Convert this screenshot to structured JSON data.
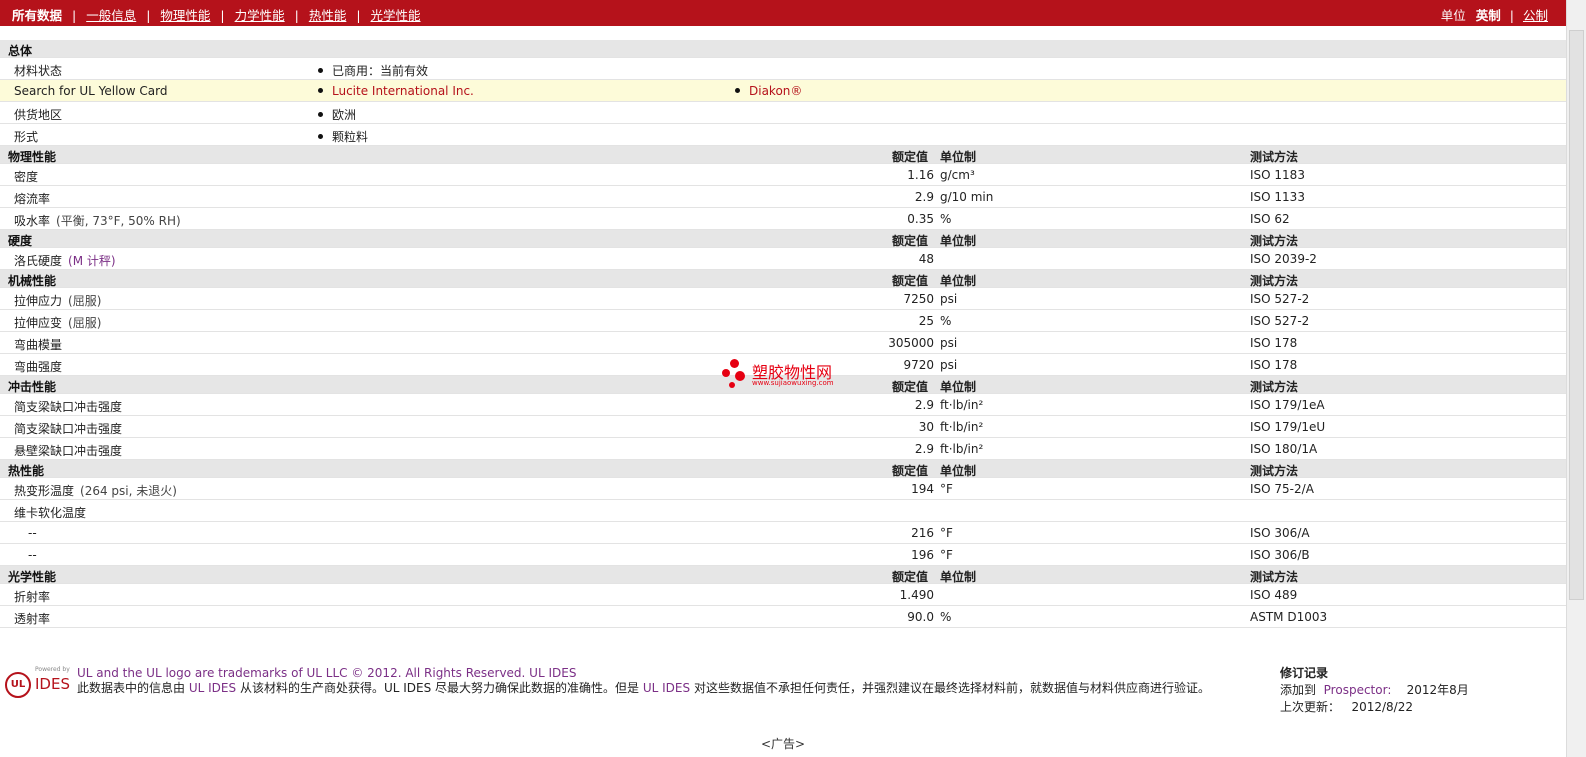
{
  "nav": {
    "current": "所有数据",
    "links": [
      "一般信息",
      "物理性能",
      "力学性能",
      "热性能",
      "光学性能"
    ],
    "separator": "|"
  },
  "units": {
    "label": "单位",
    "current": "英制",
    "separator": "|",
    "alt": "公制"
  },
  "general": {
    "title": "总体",
    "rows": [
      {
        "label": "材料状态",
        "value1": "已商用：当前有效",
        "value2": ""
      },
      {
        "label": "Search for UL Yellow Card",
        "value1": "Lucite International Inc.",
        "value2": "Diakon®"
      },
      {
        "label": "供货地区",
        "value1": "欧洲",
        "value2": ""
      },
      {
        "label": "形式",
        "value1": "颗粒料",
        "value2": ""
      }
    ]
  },
  "columns": {
    "value": "额定值",
    "unit": "单位制",
    "method": "测试方法"
  },
  "sections": [
    {
      "title": "物理性能",
      "rows": [
        {
          "label": "密度",
          "qualifier": "",
          "value": "1.16",
          "unit": "g/cm³",
          "method": "ISO 1183"
        },
        {
          "label": "熔流率",
          "qualifier": "",
          "value": "2.9",
          "unit": "g/10 min",
          "method": "ISO 1133"
        },
        {
          "label": "吸水率",
          "qualifier": "(平衡, 73°F, 50% RH)",
          "value": "0.35",
          "unit": "%",
          "method": "ISO 62"
        }
      ]
    },
    {
      "title": "硬度",
      "rows": [
        {
          "label": "洛氏硬度",
          "qualifier": "(M 计秤)",
          "value": "48",
          "unit": "",
          "method": "ISO 2039-2"
        }
      ]
    },
    {
      "title": "机械性能",
      "rows": [
        {
          "label": "拉伸应力",
          "qualifier": "(屈服)",
          "value": "7250",
          "unit": "psi",
          "method": "ISO 527-2"
        },
        {
          "label": "拉伸应变",
          "qualifier": "(屈服)",
          "value": "25",
          "unit": "%",
          "method": "ISO 527-2"
        },
        {
          "label": "弯曲模量",
          "qualifier": "",
          "value": "305000",
          "unit": "psi",
          "method": "ISO 178"
        },
        {
          "label": "弯曲强度",
          "qualifier": "",
          "value": "9720",
          "unit": "psi",
          "method": "ISO 178"
        }
      ]
    },
    {
      "title": "冲击性能",
      "rows": [
        {
          "label": "简支梁缺口冲击强度",
          "qualifier": "",
          "value": "2.9",
          "unit": "ft·lb/in²",
          "method": "ISO 179/1eA"
        },
        {
          "label": "简支梁缺口冲击强度",
          "qualifier": "",
          "value": "30",
          "unit": "ft·lb/in²",
          "method": "ISO 179/1eU"
        },
        {
          "label": "悬壁梁缺口冲击强度",
          "qualifier": "",
          "value": "2.9",
          "unit": "ft·lb/in²",
          "method": "ISO 180/1A"
        }
      ]
    },
    {
      "title": "热性能",
      "rows": [
        {
          "label": "热变形温度",
          "qualifier": "(264 psi, 未退火)",
          "value": "194",
          "unit": "°F",
          "method": "ISO 75-2/A"
        },
        {
          "label": "维卡软化温度",
          "qualifier": "",
          "value": "",
          "unit": "",
          "method": ""
        },
        {
          "label": "--",
          "qualifier": "",
          "value": "216",
          "unit": "°F",
          "method": "ISO 306/A",
          "sub": true
        },
        {
          "label": "--",
          "qualifier": "",
          "value": "196",
          "unit": "°F",
          "method": "ISO 306/B",
          "sub": true
        }
      ]
    },
    {
      "title": "光学性能",
      "rows": [
        {
          "label": "折射率",
          "qualifier": "",
          "value": "1.490",
          "unit": "",
          "method": "ISO 489"
        },
        {
          "label": "透射率",
          "qualifier": "",
          "value": "90.0",
          "unit": "%",
          "method": "ASTM D1003"
        }
      ]
    }
  ],
  "watermark": {
    "zh": "塑胶物性网",
    "en": "www.sujiaowuxing.com"
  },
  "footer": {
    "logo": {
      "powered": "Powered by",
      "ul": "UL",
      "ides": "IDES"
    },
    "trademark": "UL and the UL logo are trademarks of UL LLC © 2012. All Rights Reserved. UL IDES",
    "disclaimer_a": "此数据表中的信息由",
    "disclaimer_link1": "UL IDES",
    "disclaimer_b": "从该材料的生产商处获得。UL IDES 尽最大努力确保此数据的准确性。但是",
    "disclaimer_link2": "UL IDES",
    "disclaimer_c": "对这些数据值不承担任何责任，并强烈建议在最终选择材料前，就数据值与材料供应商进行验证。",
    "revision": {
      "title": "修订记录",
      "added_label": "添加到",
      "added_link": "Prospector:",
      "added_date": "2012年8月",
      "updated_label": "上次更新：",
      "updated_date": "2012/8/22"
    },
    "ad": "<广告>"
  },
  "colors": {
    "brand": "#b5121b",
    "link": "#7b2f86",
    "highlight": "#fdfbd9",
    "header": "#e6e6e6"
  }
}
